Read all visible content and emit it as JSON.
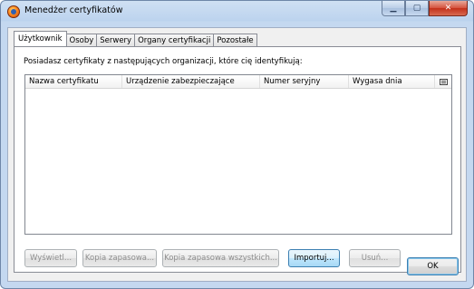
{
  "window": {
    "title": "Menedżer certyfikatów",
    "minimize_symbol": "▁",
    "maximize_symbol": "▢",
    "close_symbol": "✕"
  },
  "tabs": [
    {
      "label": "Użytkownik",
      "active": true
    },
    {
      "label": "Osoby",
      "active": false
    },
    {
      "label": "Serwery",
      "active": false
    },
    {
      "label": "Organy certyfikacji",
      "active": false
    },
    {
      "label": "Pozostałe",
      "active": false
    }
  ],
  "panel": {
    "description": "Posiadasz certyfikaty z następujących organizacji, które cię identyfikują:"
  },
  "table": {
    "columns": [
      "Nazwa certyfikatu",
      "Urządzenie zabezpieczające",
      "Numer seryjny",
      "Wygasa dnia"
    ],
    "rows": []
  },
  "buttons": {
    "view": "Wyświetl...",
    "backup": "Kopia zapasowa...",
    "backup_all": "Kopia zapasowa wszystkich...",
    "import": "Importuj...",
    "delete": "Usuń..."
  },
  "ok_label": "OK"
}
